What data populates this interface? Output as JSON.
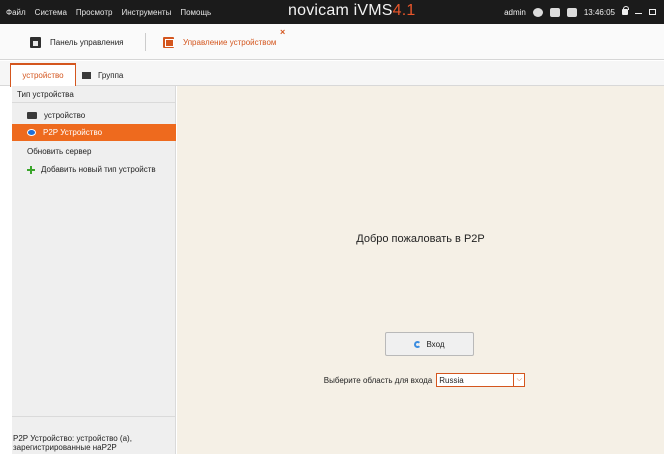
{
  "menu": [
    "Файл",
    "Система",
    "Просмотр",
    "Инструменты",
    "Помощь"
  ],
  "brand": {
    "name": "novicam iVMS",
    "version": "4.1"
  },
  "status": {
    "user": "admin",
    "time": "13:46:05"
  },
  "toolbar": {
    "home_label": "Панель управления",
    "device_label": "Управление устройством",
    "close_symbol": "×"
  },
  "tabs": {
    "device": "устройство",
    "group": "Группа"
  },
  "sidebar": {
    "header": "Тип устройства",
    "items": [
      {
        "label": "устройство"
      },
      {
        "label": "P2P Устройство"
      },
      {
        "label": "Обновить сервер"
      },
      {
        "label": "Добавить новый тип устройств"
      }
    ],
    "description": "P2P Устройство: устройство (а), зарегистрированные наP2P"
  },
  "main": {
    "welcome": "Добро пожаловать в P2P",
    "login_label": "Вход",
    "region_label": "Выберите область для входа",
    "region_value": "Russia"
  },
  "colors": {
    "accent": "#ee6a1e",
    "topbar": "#1b1b1b",
    "main_bg": "#f5f0e6"
  }
}
